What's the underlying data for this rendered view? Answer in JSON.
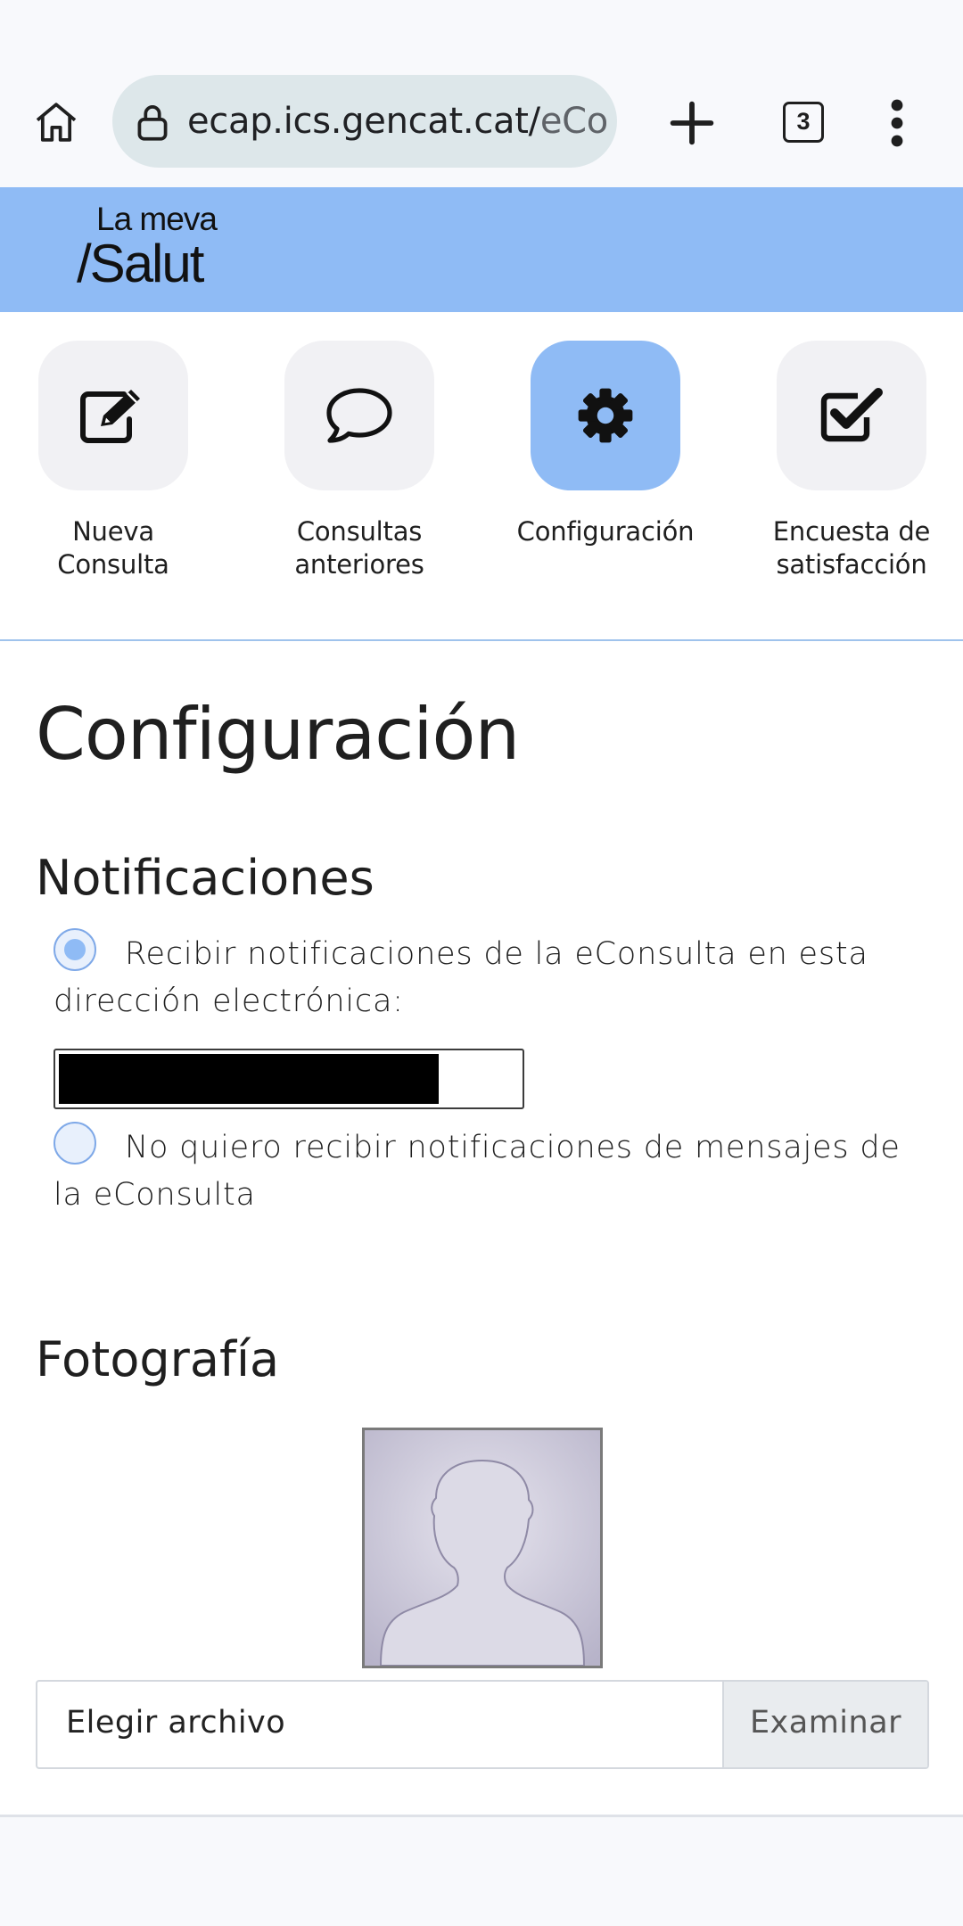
{
  "browser": {
    "url_main": "ecap.ics.gencat.cat/",
    "url_tail": "eConsulta",
    "tab_count": "3"
  },
  "header": {
    "logo_line1": "La meva",
    "logo_line2": "/Salut",
    "background_color": "#8fbbf5"
  },
  "nav": {
    "items": [
      {
        "label": "Nueva\nConsulta",
        "icon": "edit-icon",
        "active": false
      },
      {
        "label": "Consultas\nanteriores",
        "icon": "speech-bubble-icon",
        "active": false
      },
      {
        "label": "Configuración",
        "icon": "gear-icon",
        "active": true
      },
      {
        "label": "Encuesta de\nsatisfacción",
        "icon": "checkbox-checked-icon",
        "active": false
      }
    ]
  },
  "main": {
    "title": "Configuración",
    "notifications": {
      "heading": "Notificaciones",
      "option_email": "Recibir notificaciones de la eConsulta en esta dirección electrónica:",
      "option_email_selected": true,
      "email_value": "",
      "option_none": "No quiero recibir notificaciones de mensajes de la eConsulta",
      "option_none_selected": false
    },
    "photo": {
      "heading": "Fotografía",
      "file_label": "Elegir archivo",
      "browse_label": "Examinar"
    }
  }
}
